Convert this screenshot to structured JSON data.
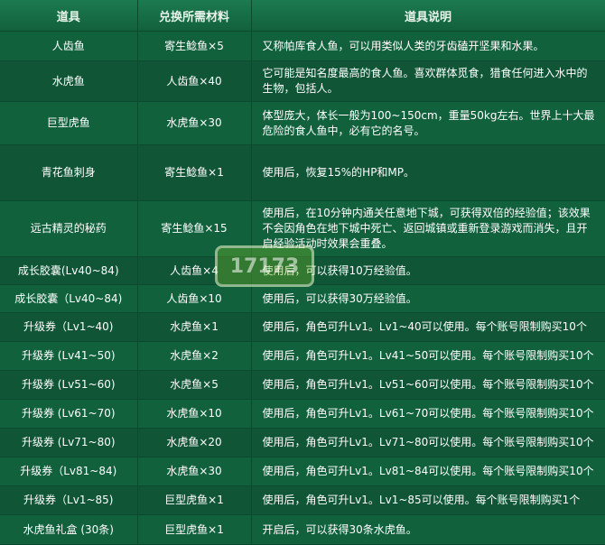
{
  "table": {
    "headers": [
      "道具",
      "兑换所需材料",
      "道具说明"
    ],
    "rows": [
      {
        "item": "人齿鱼",
        "material": "寄生鲶鱼×5",
        "desc": "又称帕库食人鱼，可以用类似人类的牙齿磕开坚果和水果。"
      },
      {
        "item": "水虎鱼",
        "material": "人齿鱼×40",
        "desc": "它可能是知名度最高的食人鱼。喜欢群体觅食，猎食任何进入水中的生物，包括人。"
      },
      {
        "item": "巨型虎鱼",
        "material": "水虎鱼×30",
        "desc": "体型庞大，体长一般为100~150cm，重量50kg左右。世界上十大最危险的食人鱼中，必有它的名号。"
      },
      {
        "item": "青花鱼刺身",
        "material": "寄生鲶鱼×1",
        "desc": "使用后，恢复15%的HP和MP。"
      },
      {
        "item": "远古精灵的秘药",
        "material": "寄生鲶鱼×15",
        "desc": "使用后，在10分钟内通关任意地下城，可获得双倍的经验值；该效果不会因角色在地下城中死亡、返回城镇或重新登录游戏而消失，且开启经验活动时效果会重叠。"
      },
      {
        "item": "成长胶囊(Lv40~84)",
        "material": "人齿鱼×4",
        "desc": "使用后，可以获得10万经验值。"
      },
      {
        "item": "成长胶囊（Lv40~84)",
        "material": "人齿鱼×10",
        "desc": "使用后，可以获得30万经验值。"
      },
      {
        "item": "升级券（Lv1~40)",
        "material": "水虎鱼×1",
        "desc": "使用后，角色可升Lv1。Lv1~40可以使用。每个账号限制购买10个"
      },
      {
        "item": "升级券 (Lv41~50)",
        "material": "水虎鱼×2",
        "desc": "使用后，角色可升Lv1。Lv41~50可以使用。每个账号限制购买10个"
      },
      {
        "item": "升级券 (Lv51~60)",
        "material": "水虎鱼×5",
        "desc": "使用后，角色可升Lv1。Lv51~60可以使用。每个账号限制购买10个"
      },
      {
        "item": "升级券 (Lv61~70)",
        "material": "水虎鱼×10",
        "desc": "使用后，角色可升Lv1。Lv61~70可以使用。每个账号限制购买10个"
      },
      {
        "item": "升级券 (Lv71~80)",
        "material": "水虎鱼×20",
        "desc": "使用后，角色可升Lv1。Lv71~80可以使用。每个账号限制购买10个"
      },
      {
        "item": "升级券（Lv81~84)",
        "material": "水虎鱼×30",
        "desc": "使用后，角色可升Lv1。Lv81~84可以使用。每个账号限制购买10个"
      },
      {
        "item": "升级券（Lv1~85)",
        "material": "巨型虎鱼×1",
        "desc": "使用后，角色可升Lv1。Lv1~85可以使用。每个账号限制购买1个"
      },
      {
        "item": "水虎鱼礼盒 (30条)",
        "material": "巨型虎鱼×1",
        "desc": "开启后，可以获得30条水虎鱼。"
      }
    ]
  },
  "watermark": {
    "text": "17173"
  }
}
